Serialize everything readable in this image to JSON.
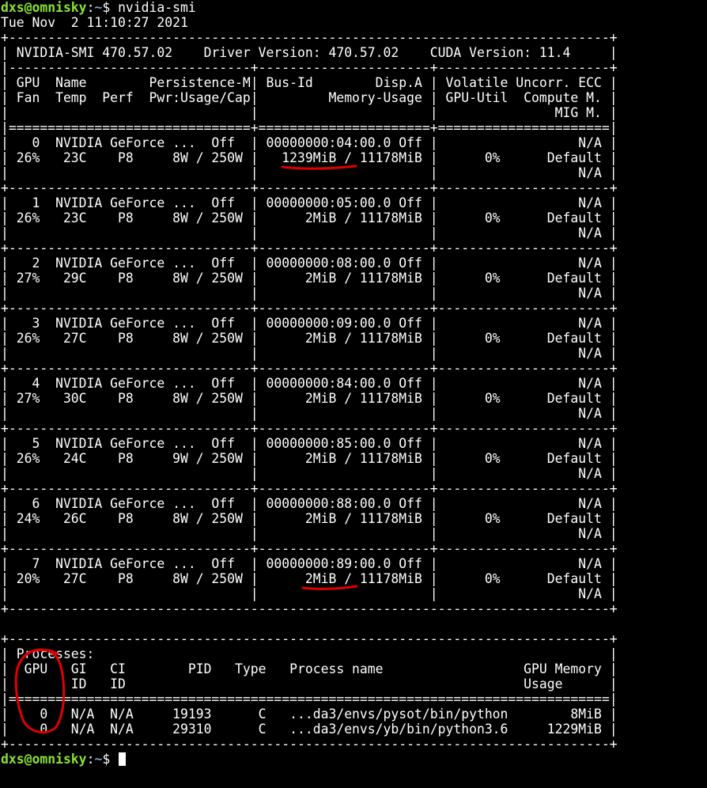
{
  "prompt": {
    "user_host": "dxs@omnisky",
    "separator": ":",
    "path": "~",
    "symbol": "$ "
  },
  "command": "nvidia-smi",
  "date_line": "Tue Nov  2 11:10:27 2021",
  "smi_table": {
    "border_top": "+-----------------------------------------------------------------------------+",
    "version_line": "| NVIDIA-SMI 470.57.02    Driver Version: 470.57.02    CUDA Version: 11.4     |",
    "row_sep": "|-------------------------------+----------------------+----------------------+",
    "header_lines": [
      "| GPU  Name        Persistence-M| Bus-Id        Disp.A | Volatile Uncorr. ECC |",
      "| Fan  Temp  Perf  Pwr:Usage/Cap|         Memory-Usage | GPU-Util  Compute M. |",
      "|                               |                      |               MIG M. |"
    ],
    "double_sep": "|===============================+======================+======================|",
    "gpu_sep": "+-------------------------------+----------------------+----------------------+",
    "gpus": [
      {
        "line1": "|   0  NVIDIA GeForce ...  Off  | 00000000:04:00.0 Off |                  N/A |",
        "line2": "| 26%   23C    P8     8W / 250W |   1239MiB / 11178MiB |      0%      Default |",
        "line3": "|                               |                      |                  N/A |"
      },
      {
        "line1": "|   1  NVIDIA GeForce ...  Off  | 00000000:05:00.0 Off |                  N/A |",
        "line2": "| 26%   23C    P8     8W / 250W |      2MiB / 11178MiB |      0%      Default |",
        "line3": "|                               |                      |                  N/A |"
      },
      {
        "line1": "|   2  NVIDIA GeForce ...  Off  | 00000000:08:00.0 Off |                  N/A |",
        "line2": "| 27%   29C    P8     8W / 250W |      2MiB / 11178MiB |      0%      Default |",
        "line3": "|                               |                      |                  N/A |"
      },
      {
        "line1": "|   3  NVIDIA GeForce ...  Off  | 00000000:09:00.0 Off |                  N/A |",
        "line2": "| 26%   27C    P8     8W / 250W |      2MiB / 11178MiB |      0%      Default |",
        "line3": "|                               |                      |                  N/A |"
      },
      {
        "line1": "|   4  NVIDIA GeForce ...  Off  | 00000000:84:00.0 Off |                  N/A |",
        "line2": "| 27%   30C    P8     8W / 250W |      2MiB / 11178MiB |      0%      Default |",
        "line3": "|                               |                      |                  N/A |"
      },
      {
        "line1": "|   5  NVIDIA GeForce ...  Off  | 00000000:85:00.0 Off |                  N/A |",
        "line2": "| 26%   24C    P8     9W / 250W |      2MiB / 11178MiB |      0%      Default |",
        "line3": "|                               |                      |                  N/A |"
      },
      {
        "line1": "|   6  NVIDIA GeForce ...  Off  | 00000000:88:00.0 Off |                  N/A |",
        "line2": "| 24%   26C    P8     8W / 250W |      2MiB / 11178MiB |      0%      Default |",
        "line3": "|                               |                      |                  N/A |"
      },
      {
        "line1": "|   7  NVIDIA GeForce ...  Off  | 00000000:89:00.0 Off |                  N/A |",
        "line2": "| 20%   27C    P8     8W / 250W |      2MiB / 11178MiB |      0%      Default |",
        "line3": "|                               |                      |                  N/A |"
      }
    ]
  },
  "processes_table": {
    "border": "+-----------------------------------------------------------------------------+",
    "title_line": "| Processes:                                                                  |",
    "header_line1": "|  GPU   GI   CI        PID   Type   Process name                  GPU Memory |",
    "header_line2": "|        ID   ID                                                   Usage      |",
    "double_sep": "|=============================================================================|",
    "rows": [
      "|    0   N/A  N/A     19193      C   ...da3/envs/pysot/bin/python        8MiB |",
      "|    0   N/A  N/A     29310      C   ...da3/envs/yb/bin/python3.6     1229MiB |"
    ]
  },
  "annotation_color": "#e00000"
}
